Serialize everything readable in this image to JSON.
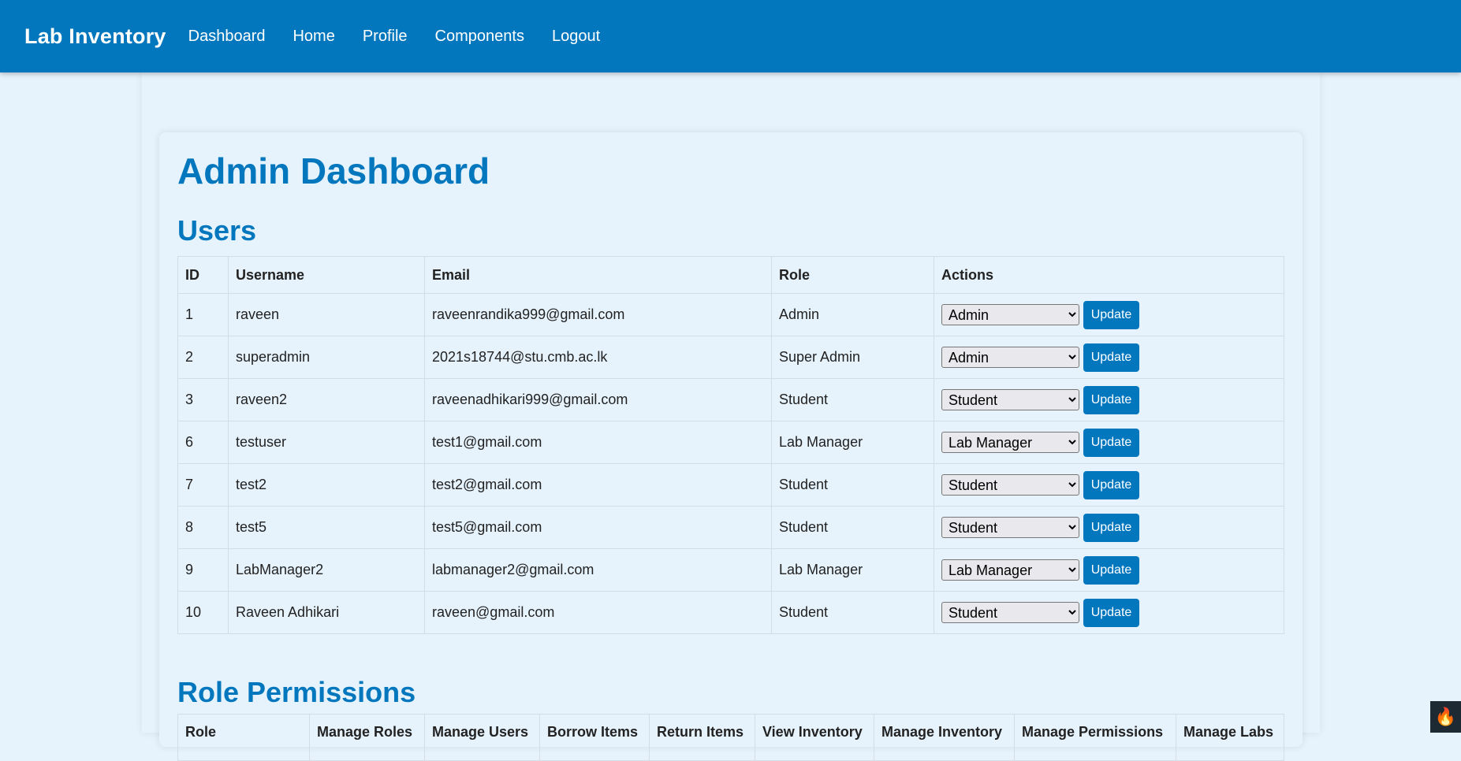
{
  "navbar": {
    "brand": "Lab Inventory",
    "links": [
      "Dashboard",
      "Home",
      "Profile",
      "Components",
      "Logout"
    ]
  },
  "page": {
    "title": "Admin Dashboard",
    "users_heading": "Users",
    "permissions_heading": "Role Permissions"
  },
  "users_table": {
    "headers": [
      "ID",
      "Username",
      "Email",
      "Role",
      "Actions"
    ],
    "update_label": "Update",
    "rows": [
      {
        "id": "1",
        "username": "raveen",
        "email": "raveenrandika999@gmail.com",
        "role": "Admin",
        "selected": "Admin"
      },
      {
        "id": "2",
        "username": "superadmin",
        "email": "2021s18744@stu.cmb.ac.lk",
        "role": "Super Admin",
        "selected": "Admin"
      },
      {
        "id": "3",
        "username": "raveen2",
        "email": "raveenadhikari999@gmail.com",
        "role": "Student",
        "selected": "Student"
      },
      {
        "id": "6",
        "username": "testuser",
        "email": "test1@gmail.com",
        "role": "Lab Manager",
        "selected": "Lab Manager"
      },
      {
        "id": "7",
        "username": "test2",
        "email": "test2@gmail.com",
        "role": "Student",
        "selected": "Student"
      },
      {
        "id": "8",
        "username": "test5",
        "email": "test5@gmail.com",
        "role": "Student",
        "selected": "Student"
      },
      {
        "id": "9",
        "username": "LabManager2",
        "email": "labmanager2@gmail.com",
        "role": "Lab Manager",
        "selected": "Lab Manager"
      },
      {
        "id": "10",
        "username": "Raveen Adhikari",
        "email": "raveen@gmail.com",
        "role": "Student",
        "selected": "Student"
      }
    ]
  },
  "permissions_table": {
    "headers": [
      "Role",
      "Manage Roles",
      "Manage Users",
      "Borrow Items",
      "Return Items",
      "View Inventory",
      "Manage Inventory",
      "Manage Permissions",
      "Manage Labs"
    ]
  },
  "colors": {
    "accent": "#0277bd",
    "background": "#e6f3fd"
  },
  "icons": {
    "corner_badge": "fire-icon"
  }
}
